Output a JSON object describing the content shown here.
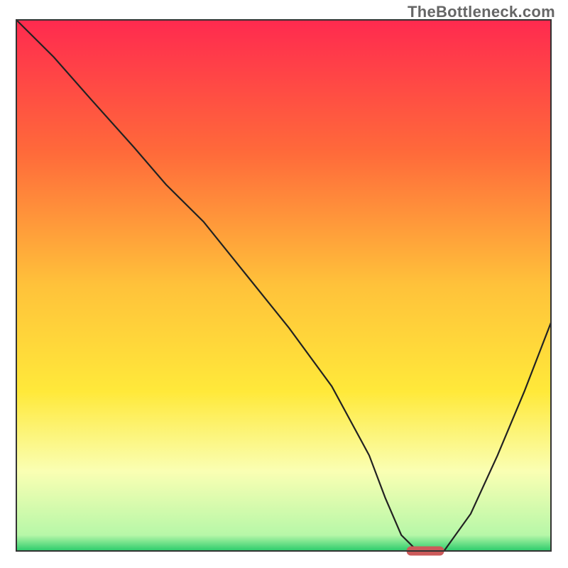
{
  "watermark": "TheBottleneck.com",
  "chart_data": {
    "type": "line",
    "title": "",
    "xlabel": "",
    "ylabel": "",
    "xlim": [
      0,
      100
    ],
    "ylim": [
      0,
      100
    ],
    "grid": false,
    "watermark": "TheBottleneck.com",
    "background_gradient": {
      "stops": [
        {
          "pct": 0,
          "color": "#ff2a4f"
        },
        {
          "pct": 25,
          "color": "#ff6a3a"
        },
        {
          "pct": 50,
          "color": "#ffc23a"
        },
        {
          "pct": 70,
          "color": "#ffe93a"
        },
        {
          "pct": 85,
          "color": "#faffb3"
        },
        {
          "pct": 97,
          "color": "#b7f7a8"
        },
        {
          "pct": 100,
          "color": "#2acb6b"
        }
      ]
    },
    "series": [
      {
        "name": "bottleneck-curve",
        "color": "#222222",
        "x": [
          0,
          7,
          14,
          22,
          28,
          35,
          43,
          51,
          59,
          66,
          69,
          72,
          75,
          80,
          85,
          90,
          95,
          100
        ],
        "y": [
          100,
          93,
          85,
          76,
          69,
          62,
          52,
          42,
          31,
          18,
          10,
          3,
          0,
          0,
          7,
          18,
          30,
          43
        ]
      }
    ],
    "marker": {
      "name": "optimal-marker",
      "x_range": [
        73,
        80
      ],
      "y": 0,
      "color": "#cc5a5a"
    }
  }
}
